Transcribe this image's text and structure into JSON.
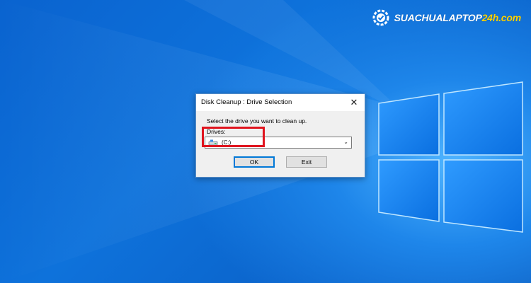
{
  "logo": {
    "text_main": "SUACHUALAPTOP",
    "text_accent": "24h.com",
    "icon": "gear-check-icon"
  },
  "dialog": {
    "title": "Disk Cleanup : Drive Selection",
    "close_icon": "close-icon",
    "prompt": "Select the drive you want to clean up.",
    "drives_label": "Drives:",
    "selected_drive": "(C:)",
    "drive_icon": "hard-drive-icon",
    "ok_label": "OK",
    "exit_label": "Exit"
  },
  "annotation": {
    "highlight_color": "#e0141e"
  },
  "colors": {
    "desktop_blue": "#0e72db",
    "logo_accent": "#ffd200"
  }
}
